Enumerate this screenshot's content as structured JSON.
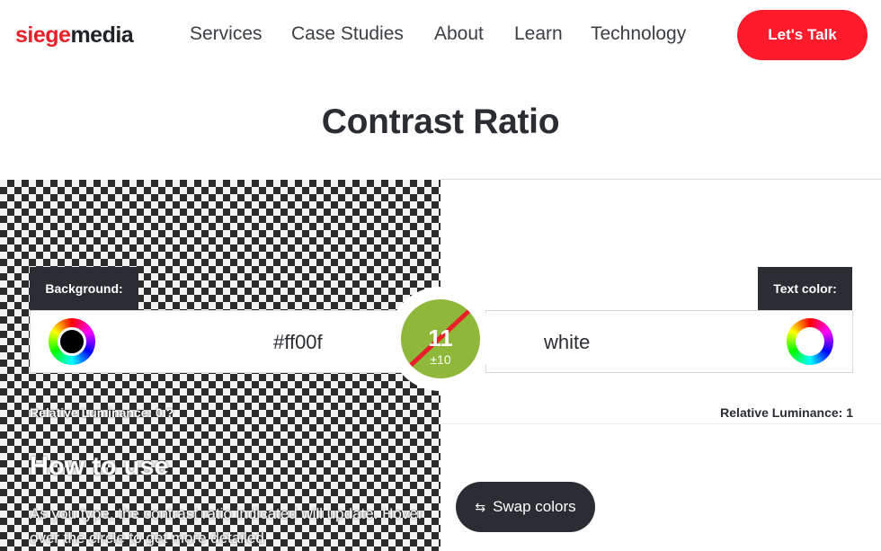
{
  "header": {
    "logo_part1": "siege",
    "logo_part2": "media",
    "nav": [
      "Services",
      "Case Studies",
      "About",
      "Learn",
      "Technology"
    ],
    "cta_label": "Let's Talk"
  },
  "page": {
    "title": "Contrast Ratio"
  },
  "background": {
    "label": "Background:",
    "value": "#ff00f",
    "luminance_label": "Relative Luminance:",
    "luminance_value": "0",
    "luminance_extra": "?"
  },
  "text": {
    "label": "Text color:",
    "value": "white",
    "luminance_label": "Relative Luminance:",
    "luminance_value": "1"
  },
  "ratio": {
    "value": "11",
    "error": "±10"
  },
  "swap": {
    "label": "Swap colors",
    "icon": "swap-arrows-icon"
  },
  "howto": {
    "title": "How to use",
    "text": "As you type, the contrast ratio indicated will update. Hover over the circle to get more detailed"
  },
  "colors": {
    "brand": "#e8202a",
    "cta": "#ff1a2c",
    "dark": "#2a2d31",
    "ratio_bg": "#8fb83a"
  }
}
